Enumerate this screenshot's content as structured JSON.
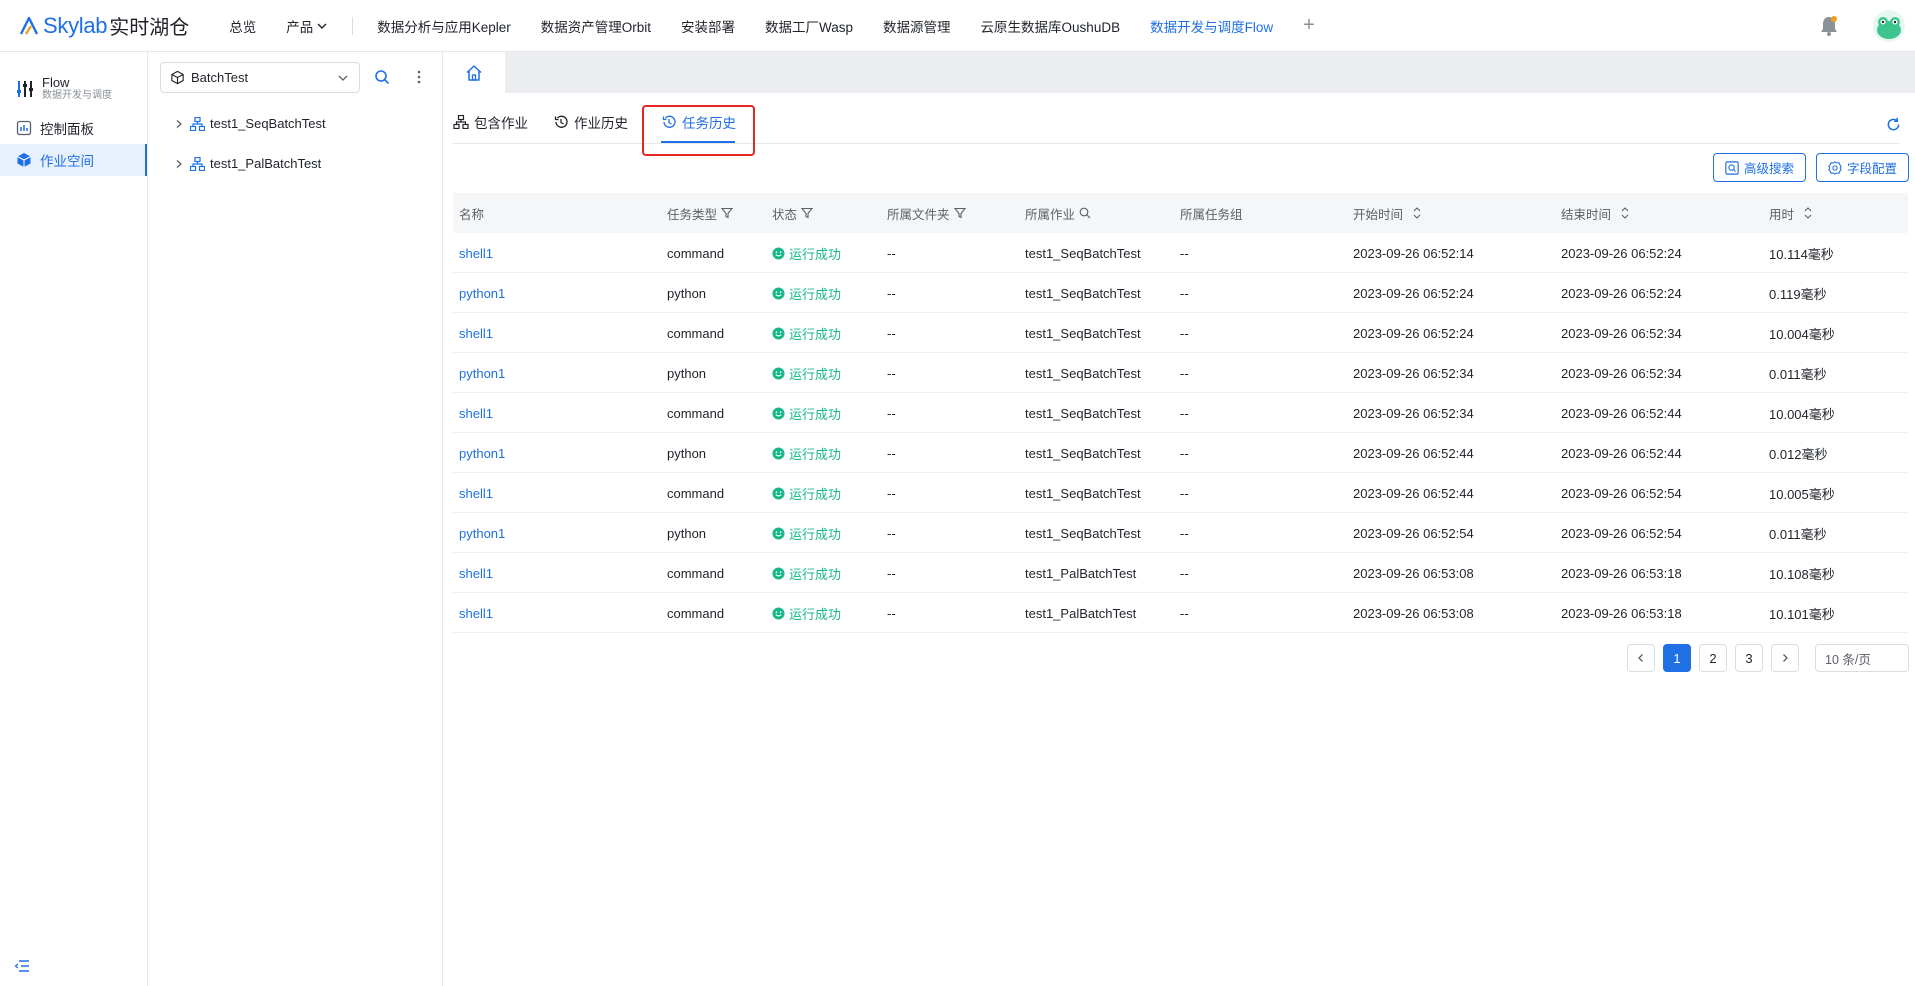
{
  "topbar": {
    "logo_text": "Skylab",
    "logo_cn": "实时湖仓",
    "nav": [
      {
        "label": "总览"
      },
      {
        "label": "产品"
      },
      {
        "label": "数据分析与应用Kepler"
      },
      {
        "label": "数据资产管理Orbit"
      },
      {
        "label": "安装部署"
      },
      {
        "label": "数据工厂Wasp"
      },
      {
        "label": "数据源管理"
      },
      {
        "label": "云原生数据库OushuDB"
      },
      {
        "label": "数据开发与调度Flow"
      }
    ],
    "plus": "+"
  },
  "leftnav": {
    "title": "Flow",
    "subtitle": "数据开发与调度",
    "items": [
      {
        "label": "控制面板"
      },
      {
        "label": "作业空间"
      }
    ]
  },
  "tree": {
    "workspace": "BatchTest",
    "nodes": [
      {
        "label": "test1_SeqBatchTest"
      },
      {
        "label": "test1_PalBatchTest"
      }
    ]
  },
  "subtabs": [
    {
      "label": "包含作业"
    },
    {
      "label": "作业历史"
    },
    {
      "label": "任务历史"
    }
  ],
  "buttons": {
    "advanced_search": "高级搜索",
    "field_config": "字段配置"
  },
  "table": {
    "columns": [
      "名称",
      "任务类型",
      "状态",
      "所属文件夹",
      "所属作业",
      "所属任务组",
      "开始时间",
      "结束时间",
      "用时"
    ],
    "rows": [
      {
        "name": "shell1",
        "type": "command",
        "status": "运行成功",
        "folder": "--",
        "job": "test1_SeqBatchTest",
        "group": "--",
        "start": "2023-09-26 06:52:14",
        "end": "2023-09-26 06:52:24",
        "duration": "10.114毫秒"
      },
      {
        "name": "python1",
        "type": "python",
        "status": "运行成功",
        "folder": "--",
        "job": "test1_SeqBatchTest",
        "group": "--",
        "start": "2023-09-26 06:52:24",
        "end": "2023-09-26 06:52:24",
        "duration": "0.119毫秒"
      },
      {
        "name": "shell1",
        "type": "command",
        "status": "运行成功",
        "folder": "--",
        "job": "test1_SeqBatchTest",
        "group": "--",
        "start": "2023-09-26 06:52:24",
        "end": "2023-09-26 06:52:34",
        "duration": "10.004毫秒"
      },
      {
        "name": "python1",
        "type": "python",
        "status": "运行成功",
        "folder": "--",
        "job": "test1_SeqBatchTest",
        "group": "--",
        "start": "2023-09-26 06:52:34",
        "end": "2023-09-26 06:52:34",
        "duration": "0.011毫秒"
      },
      {
        "name": "shell1",
        "type": "command",
        "status": "运行成功",
        "folder": "--",
        "job": "test1_SeqBatchTest",
        "group": "--",
        "start": "2023-09-26 06:52:34",
        "end": "2023-09-26 06:52:44",
        "duration": "10.004毫秒"
      },
      {
        "name": "python1",
        "type": "python",
        "status": "运行成功",
        "folder": "--",
        "job": "test1_SeqBatchTest",
        "group": "--",
        "start": "2023-09-26 06:52:44",
        "end": "2023-09-26 06:52:44",
        "duration": "0.012毫秒"
      },
      {
        "name": "shell1",
        "type": "command",
        "status": "运行成功",
        "folder": "--",
        "job": "test1_SeqBatchTest",
        "group": "--",
        "start": "2023-09-26 06:52:44",
        "end": "2023-09-26 06:52:54",
        "duration": "10.005毫秒"
      },
      {
        "name": "python1",
        "type": "python",
        "status": "运行成功",
        "folder": "--",
        "job": "test1_SeqBatchTest",
        "group": "--",
        "start": "2023-09-26 06:52:54",
        "end": "2023-09-26 06:52:54",
        "duration": "0.011毫秒"
      },
      {
        "name": "shell1",
        "type": "command",
        "status": "运行成功",
        "folder": "--",
        "job": "test1_PalBatchTest",
        "group": "--",
        "start": "2023-09-26 06:53:08",
        "end": "2023-09-26 06:53:18",
        "duration": "10.108毫秒"
      },
      {
        "name": "shell1",
        "type": "command",
        "status": "运行成功",
        "folder": "--",
        "job": "test1_PalBatchTest",
        "group": "--",
        "start": "2023-09-26 06:53:08",
        "end": "2023-09-26 06:53:18",
        "duration": "10.101毫秒"
      }
    ]
  },
  "pagination": {
    "pages": [
      "1",
      "2",
      "3"
    ],
    "current": "1",
    "page_size": "10 条/页"
  },
  "colors": {
    "accent": "#1f6fe5",
    "success": "#19b78a",
    "highlight": "#e5281f"
  }
}
